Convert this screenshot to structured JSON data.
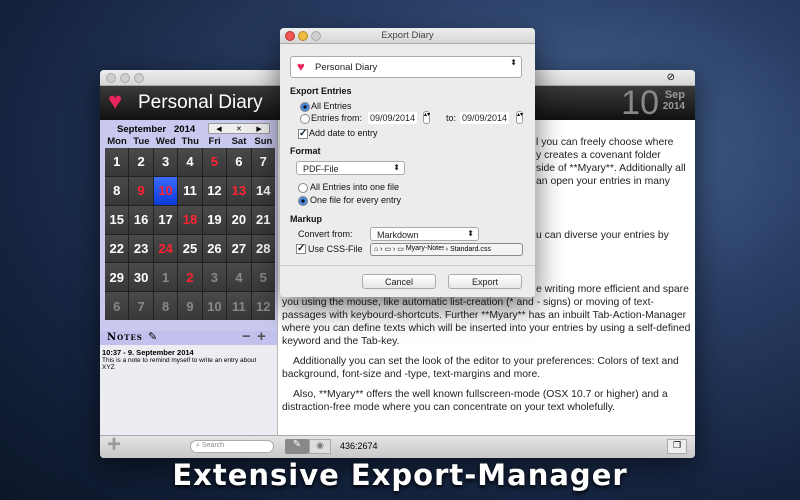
{
  "app": {
    "title": "Personal Diary",
    "date_day": "10",
    "date_month": "Sep",
    "date_year": "2014"
  },
  "calendar": {
    "month": "September",
    "year": "2014",
    "days": [
      "Mon",
      "Tue",
      "Wed",
      "Thu",
      "Fri",
      "Sat",
      "Sun"
    ],
    "cells": [
      [
        "1",
        ""
      ],
      [
        "2",
        ""
      ],
      [
        "3",
        ""
      ],
      [
        "4",
        ""
      ],
      [
        "5",
        "r"
      ],
      [
        "6",
        ""
      ],
      [
        "7",
        ""
      ],
      [
        "8",
        ""
      ],
      [
        "9",
        "r"
      ],
      [
        "10",
        "r sel"
      ],
      [
        "11",
        ""
      ],
      [
        "12",
        ""
      ],
      [
        "13",
        "r"
      ],
      [
        "14",
        ""
      ],
      [
        "15",
        ""
      ],
      [
        "16",
        ""
      ],
      [
        "17",
        ""
      ],
      [
        "18",
        "r"
      ],
      [
        "19",
        ""
      ],
      [
        "20",
        ""
      ],
      [
        "21",
        ""
      ],
      [
        "22",
        ""
      ],
      [
        "23",
        ""
      ],
      [
        "24",
        "r"
      ],
      [
        "25",
        ""
      ],
      [
        "26",
        ""
      ],
      [
        "27",
        ""
      ],
      [
        "28",
        ""
      ],
      [
        "29",
        ""
      ],
      [
        "30",
        ""
      ],
      [
        "1",
        "o"
      ],
      [
        "2",
        "r"
      ],
      [
        "3",
        "o"
      ],
      [
        "4",
        "o"
      ],
      [
        "5",
        "o"
      ],
      [
        "6",
        "o"
      ],
      [
        "7",
        "o"
      ],
      [
        "8",
        "o"
      ],
      [
        "9",
        "o"
      ],
      [
        "10",
        "o"
      ],
      [
        "11",
        "o"
      ],
      [
        "12",
        "o"
      ]
    ],
    "nav": [
      "◀",
      "✕",
      "▶"
    ]
  },
  "notes": {
    "title": "Notes",
    "minus": "−",
    "plus": "+",
    "entry_title": "10:37 - 9. September 2014",
    "entry_text": "This is a note to remind myself to write an entry about XYZ"
  },
  "text_lines": [
    "l you can freely choose where",
    "y creates a covenant folder",
    "side of **Myary**. Additionally all",
    "an open your entries in many",
    "u can diverse your entries by",
    "e writing more efficient and spare",
    "you using the mouse, like automatic list-creation (* and - signs) or moving of text-",
    "passages with keybourd-shortcuts. Further **Myary** has an inbuilt Tab-Action-Manager",
    "where you can define texts which will be inserted into your entries by using a self-defined",
    "keyword and the Tab-key.",
    "    Additionally you can set the look of the editor to your preferences: Colors of text and",
    "background, font-size and -type, text-margins and more.",
    "    Also, **Myary** offers the well known fullscreen-mode (OSX 10.7 or higher) and a",
    "distraction-free mode where you can concentrate on your text wholefully."
  ],
  "bottom": {
    "search_placeholder": "Search",
    "position": "436:2674"
  },
  "dialog": {
    "title": "Export Diary",
    "diary": "Personal Diary",
    "export_entries": "Export Entries",
    "all_entries": "All Entries",
    "entries_from": "Entries from:",
    "from_date": "09/09/2014",
    "to_label": "to:",
    "to_date": "09/09/2014",
    "add_date": "Add date to entry",
    "format": "Format",
    "format_value": "PDF-File",
    "into_one": "All Entries into one file",
    "one_per": "One file for every entry",
    "markup": "Markup",
    "convert_from": "Convert from:",
    "convert_value": "Markdown",
    "use_css": "Use CSS-File",
    "path": [
      "Myary-Notes",
      "Standard.css"
    ],
    "cancel": "Cancel",
    "export": "Export"
  },
  "caption": "Extensive Export-Manager",
  "colors": {
    "accent": "#3a6cff",
    "red": "#f22233",
    "lavender": "#c9c8ee",
    "heart": "#e8245a"
  }
}
